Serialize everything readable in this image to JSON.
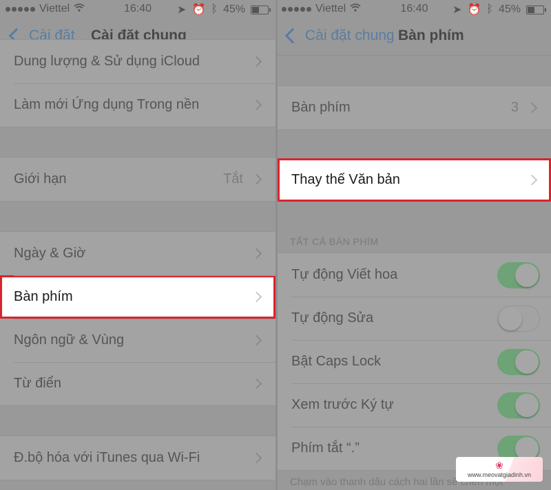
{
  "status_bar": {
    "carrier": "Viettel",
    "time": "16:40",
    "battery_percent": "45%",
    "battery_level": 0.45,
    "icons": [
      "signal-dots-icon",
      "wifi-icon",
      "location-arrow-icon",
      "alarm-icon",
      "bluetooth-icon",
      "battery-icon"
    ]
  },
  "left": {
    "back_label": "Cài đặt",
    "title": "Cài đặt chung",
    "groups": [
      {
        "items": [
          {
            "label": "Dung lượng & Sử dụng iCloud"
          },
          {
            "label": "Làm mới Ứng dụng Trong nền"
          }
        ]
      },
      {
        "items": [
          {
            "label": "Giới hạn",
            "value": "Tắt"
          }
        ]
      },
      {
        "items": [
          {
            "label": "Ngày & Giờ"
          },
          {
            "label": "Bàn phím",
            "highlighted": true
          },
          {
            "label": "Ngôn ngữ & Vùng"
          },
          {
            "label": "Từ điển"
          }
        ]
      },
      {
        "items": [
          {
            "label": "Đ.bộ hóa với iTunes qua Wi-Fi"
          }
        ]
      }
    ]
  },
  "right": {
    "back_label": "Cài đặt chung",
    "title": "Bàn phím",
    "keyboards": {
      "label": "Bàn phím",
      "value": "3"
    },
    "text_replacement": {
      "label": "Thay thế Văn bản",
      "highlighted": true
    },
    "section_header": "TẤT CẢ BÀN PHÍM",
    "toggles": [
      {
        "label": "Tự động Viết hoa",
        "on": true
      },
      {
        "label": "Tự động Sửa",
        "on": false
      },
      {
        "label": "Bật Caps Lock",
        "on": true
      },
      {
        "label": "Xem trước Ký tự",
        "on": true
      },
      {
        "label": "Phím tắt “.”",
        "on": true
      }
    ],
    "footer": "Chạm vào thanh dấu cách hai lần sẽ chèn một"
  },
  "watermark": {
    "text": "www.meovatgiadinh.vn",
    "icon": "lotus-icon"
  },
  "colors": {
    "highlight_border": "#d9232d",
    "link": "#5a7da0",
    "toggle_on": "#6da377"
  }
}
